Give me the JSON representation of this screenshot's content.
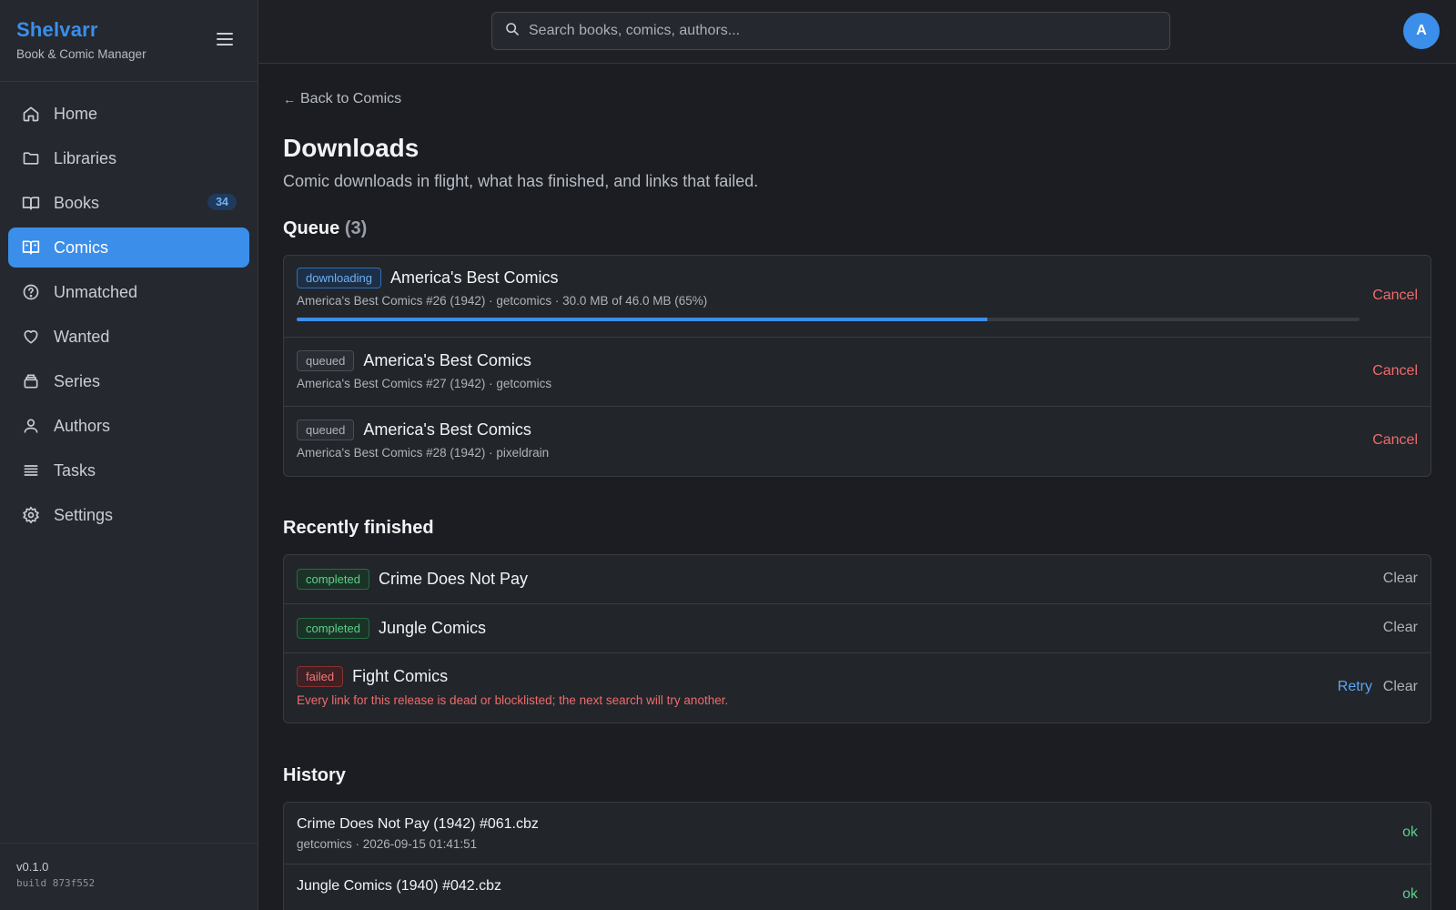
{
  "app": {
    "name": "Shelvarr",
    "subtitle": "Book & Comic Manager",
    "version": "v0.1.0",
    "build": "build 873f552"
  },
  "sidebar": {
    "items": [
      {
        "label": "Home",
        "icon": "home-icon"
      },
      {
        "label": "Libraries",
        "icon": "folder-icon"
      },
      {
        "label": "Books",
        "icon": "book-icon",
        "badge": "34"
      },
      {
        "label": "Comics",
        "icon": "comic-icon",
        "active": true
      },
      {
        "label": "Unmatched",
        "icon": "question-icon"
      },
      {
        "label": "Wanted",
        "icon": "heart-icon"
      },
      {
        "label": "Series",
        "icon": "stack-icon"
      },
      {
        "label": "Authors",
        "icon": "user-icon"
      },
      {
        "label": "Tasks",
        "icon": "list-icon"
      },
      {
        "label": "Settings",
        "icon": "gear-icon"
      }
    ]
  },
  "topbar": {
    "search_placeholder": "Search books, comics, authors...",
    "avatar_initial": "A"
  },
  "page": {
    "back_label": "Back to Comics",
    "title": "Downloads",
    "description": "Comic downloads in flight, what has finished, and links that failed."
  },
  "queue": {
    "title": "Queue",
    "count": "(3)",
    "items": [
      {
        "status": "downloading",
        "title": "America's Best Comics",
        "detail": "America's Best Comics #26 (1942) · getcomics · 30.0 MB of 46.0 MB (65%)",
        "progress": 0.65,
        "action": "Cancel"
      },
      {
        "status": "queued",
        "title": "America's Best Comics",
        "detail": "America's Best Comics #27 (1942) · getcomics",
        "action": "Cancel"
      },
      {
        "status": "queued",
        "title": "America's Best Comics",
        "detail": "America's Best Comics #28 (1942) · pixeldrain",
        "action": "Cancel"
      }
    ]
  },
  "finished": {
    "title": "Recently finished",
    "items": [
      {
        "status": "completed",
        "title": "Crime Does Not Pay",
        "action": "Clear"
      },
      {
        "status": "completed",
        "title": "Jungle Comics",
        "action": "Clear"
      },
      {
        "status": "failed",
        "title": "Fight Comics",
        "error": "Every link for this release is dead or blocklisted; the next search will try another.",
        "retry": "Retry",
        "action": "Clear"
      }
    ]
  },
  "history": {
    "title": "History",
    "items": [
      {
        "file": "Crime Does Not Pay (1942) #061.cbz",
        "meta": "getcomics · 2026-09-15 01:41:51",
        "result": "ok"
      },
      {
        "file": "Jungle Comics (1940) #042.cbz",
        "meta": "",
        "result": "ok"
      }
    ]
  },
  "colors": {
    "accent": "#3b8eea",
    "danger": "#ef6b6b",
    "success": "#59d18a",
    "background": "#1b1d22",
    "panel": "#25282e"
  }
}
